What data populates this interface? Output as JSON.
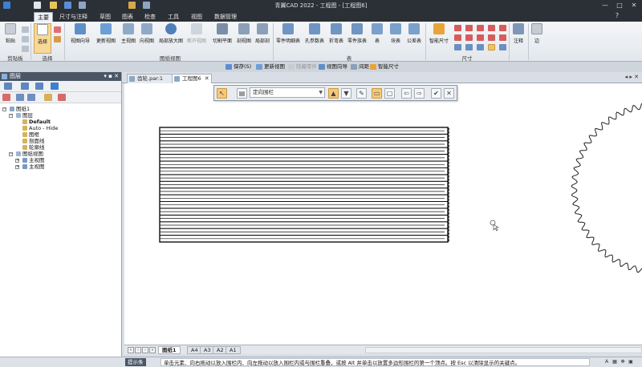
{
  "window": {
    "title": "青翼CAD 2022 - 工程图 - [工程图6]",
    "minimize": "—",
    "maximize": "□",
    "close": "✕"
  },
  "ribbon": {
    "tabs": [
      "主要",
      "尺寸与注释",
      "草图",
      "图表",
      "检查",
      "工具",
      "视图",
      "数据管理"
    ],
    "active_tab": 0,
    "groups": {
      "clipboard": "剪贴板",
      "select": "选择",
      "drawing_views": "图纸视图",
      "tables": "表",
      "dimensions": "尺寸"
    },
    "buttons": {
      "paste": "粘贴",
      "select": "选择",
      "view_wizard": "视图向导",
      "update_views": "更新视图",
      "main_view": "主视图",
      "aux_view": "向视图",
      "detail_view": "局部放大图",
      "broken_view": "断开视图",
      "cutting_plane": "切割平面",
      "section_view": "剖视图",
      "local_section": "局部剖",
      "parts_list": "零件明细表",
      "hole_table": "孔参数表",
      "bend_table": "折弯表",
      "part_table": "零件族表",
      "table": "表",
      "block_table": "块表",
      "tolerance_table": "公差表",
      "smart_dimension": "智能尺寸",
      "annotation": "注释",
      "edge": "边"
    }
  },
  "context_bar": {
    "save": "保存(S)",
    "update_view": "更新视图",
    "hidden_edges": "隐藏零件",
    "view_wizard": "视图向导",
    "spacing": "间距",
    "smart_dimension": "智能尺寸"
  },
  "left_panel": {
    "title": "图层",
    "tree": {
      "root": "图纸1",
      "layers": "图层",
      "default": "Default",
      "auto_hide": "Auto - Hide",
      "l1": "图框",
      "l2": "剖面线",
      "l3": "轮廓线",
      "views": "图纸视图",
      "v1": "主视图",
      "v2": "主视图"
    }
  },
  "documents": {
    "tabs": [
      "齿轮.par:1",
      "工程图6"
    ],
    "active": 1
  },
  "float_toolbar": {
    "dropdown_value": "定向围栏"
  },
  "sheets": {
    "tabs": [
      "图纸1",
      "A4",
      "A3",
      "A2",
      "A1"
    ],
    "active": 0
  },
  "status": {
    "label": "提示条",
    "message": "单击元素、向右拖动以放入围栏内、向左拖动以放入围栏内或与围栏重叠，或按 Alt 并单击以放置多边形围栏的第一个顶点。按 Esc 以清除显示的关键点。"
  },
  "colors": {
    "titlebar": "#2b2f36",
    "ribbon_bg": "#e3e7ec",
    "active_tool": "#f6c878",
    "panel_header": "#4a5666"
  }
}
